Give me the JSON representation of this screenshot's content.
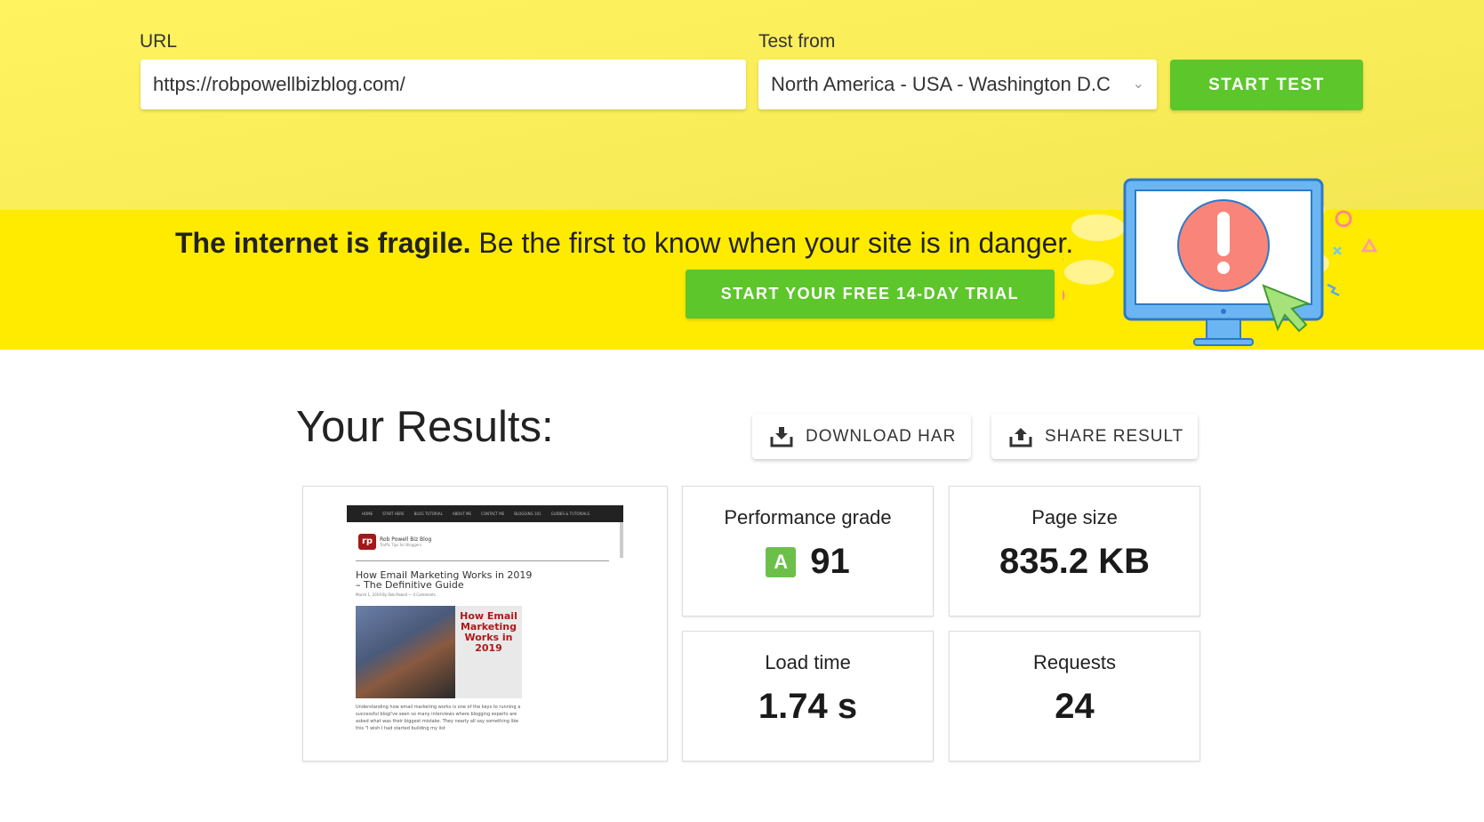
{
  "form": {
    "url_label": "URL",
    "url_value": "https://robpowellbizblog.com/",
    "location_label": "Test from",
    "location_value": "North America - USA - Washington D.C",
    "start_label": "START TEST"
  },
  "banner": {
    "bold": "The internet is fragile.",
    "text": " Be the first to know when your site is in danger.",
    "cta": "START YOUR FREE 14-DAY TRIAL"
  },
  "results": {
    "title": "Your Results:",
    "download_label": "DOWNLOAD HAR",
    "share_label": "SHARE RESULT"
  },
  "metrics": {
    "grade": {
      "label": "Performance grade",
      "letter": "A",
      "value": "91"
    },
    "size": {
      "label": "Page size",
      "value": "835.2 KB"
    },
    "load": {
      "label": "Load time",
      "value": "1.74 s"
    },
    "requests": {
      "label": "Requests",
      "value": "24"
    }
  },
  "screenshot": {
    "nav": [
      "HOME",
      "START HERE",
      "BLOG TUTORIAL",
      "ABOUT ME",
      "CONTACT ME",
      "BLOGGING 101",
      "GUIDES & TUTORIALS"
    ],
    "logo": "rp",
    "site_name": "Rob Powell Biz Blog",
    "tagline": "Traffic Tips for Bloggers",
    "post_title": "How Email Marketing Works in 2019 – The Definitive Guide",
    "meta": "March 1, 2019 By Rob Powell — 4 Comments",
    "image_text": "How Email Marketing Works in 2019",
    "body": "Understanding how email marketing works is one of the keys to running a successful blogI've seen so many interviews where blogging experts are asked what was their biggest mistake. They nearly all say something like this \"I wish I had started building my list"
  },
  "colors": {
    "accent_green": "#5cc62b",
    "banner_yellow": "#ffeb00",
    "grade_green": "#6cc04a"
  }
}
